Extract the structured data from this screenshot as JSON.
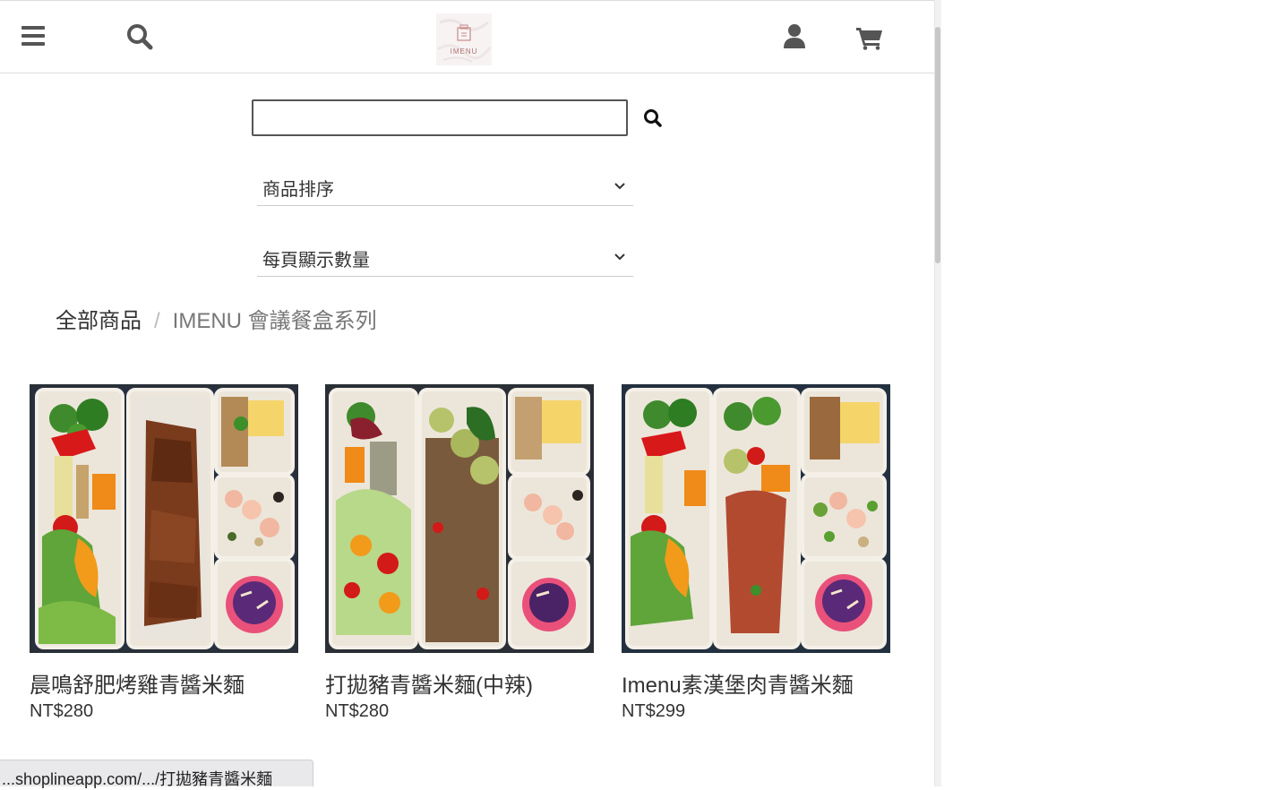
{
  "header": {
    "menu_icon": "hamburger-icon",
    "search_icon": "search-icon",
    "logo_text": "IMENU",
    "account_icon": "user-icon",
    "cart_icon": "cart-icon"
  },
  "search": {
    "value": "",
    "placeholder": ""
  },
  "filters": {
    "sort_label": "商品排序",
    "per_page_label": "每頁顯示數量"
  },
  "breadcrumb": {
    "root": "全部商品",
    "separator": "/",
    "current": "IMENU 會議餐盒系列"
  },
  "products": [
    {
      "title": "晨鳴舒肥烤雞青醬米麵",
      "price": "NT$280"
    },
    {
      "title": "打拋豬青醬米麵(中辣)",
      "price": "NT$280"
    },
    {
      "title": "Imenu素漢堡肉青醬米麵",
      "price": "NT$299"
    }
  ],
  "status_bar": {
    "url": "...shoplineapp.com/.../打拋豬青醬米麵"
  },
  "colors": {
    "icon_gray": "#555555",
    "border_light": "#dddddd",
    "text_dark": "#333333",
    "text_muted": "#777777"
  }
}
